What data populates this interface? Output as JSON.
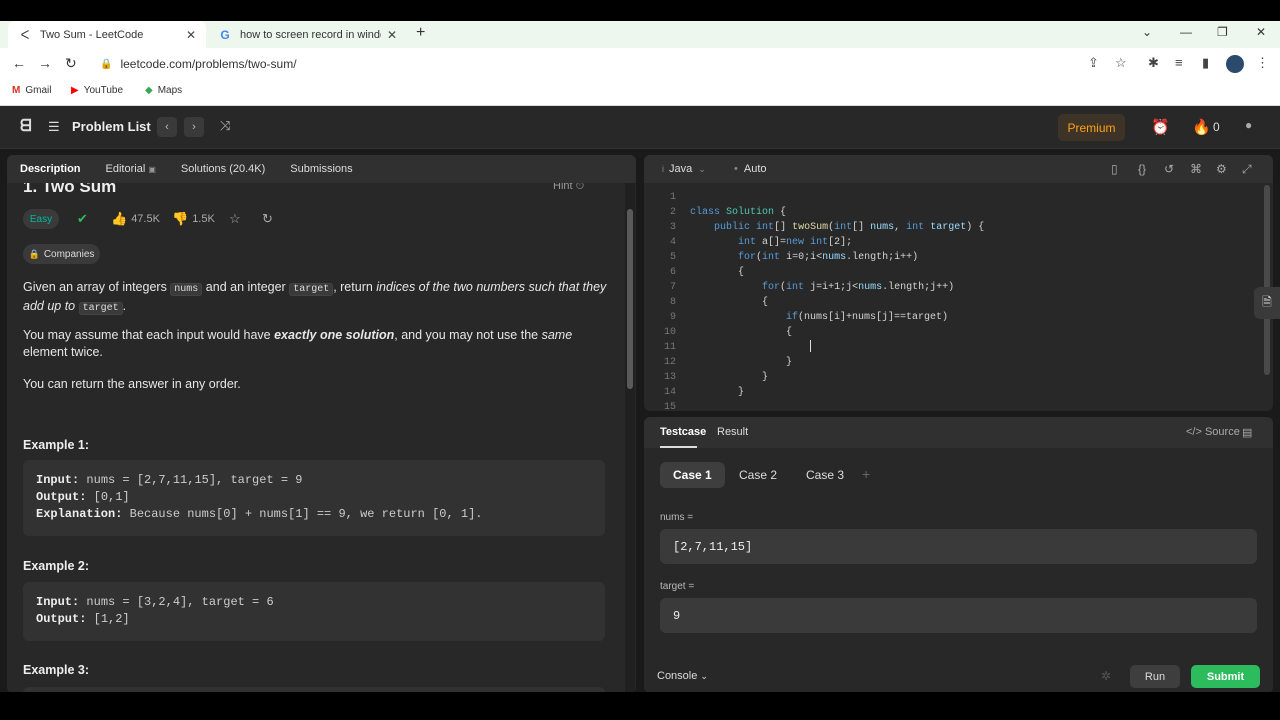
{
  "browser": {
    "tabs": [
      {
        "title": "Two Sum - LeetCode",
        "icon": "leetcode-icon"
      },
      {
        "title": "how to screen record in window",
        "icon": "google-icon"
      }
    ],
    "url": "leetcode.com/problems/two-sum/",
    "bookmarks": [
      {
        "label": "Gmail",
        "icon": "gmail-icon"
      },
      {
        "label": "YouTube",
        "icon": "youtube-icon"
      },
      {
        "label": "Maps",
        "icon": "maps-icon"
      }
    ]
  },
  "navbar": {
    "problem_list": "Problem List",
    "premium": "Premium",
    "streak": "0"
  },
  "left_tabs": [
    "Description",
    "Editorial",
    "Solutions (20.4K)",
    "Submissions"
  ],
  "problem": {
    "title": "1. Two Sum",
    "hint": "Hint",
    "difficulty": "Easy",
    "likes": "47.5K",
    "dislikes": "1.5K",
    "companies": "Companies",
    "p1_a": "Given an array of integers ",
    "p1_code1": "nums",
    "p1_b": " and an integer ",
    "p1_code2": "target",
    "p1_c": ", return ",
    "p1_em": "indices of the two numbers such that they add up to",
    "p1_code3": "target",
    "p1_d": ".",
    "p2_a": "You may assume that each input would have ",
    "p2_strong": "exactly one solution",
    "p2_b": ", and you may not use the ",
    "p2_em": "same",
    "p2_c": " element twice.",
    "p3": "You can return the answer in any order.",
    "examples": [
      {
        "title": "Example 1:",
        "input": "nums = [2,7,11,15], target = 9",
        "output": "[0,1]",
        "explanation": "Because nums[0] + nums[1] == 9, we return [0, 1]."
      },
      {
        "title": "Example 2:",
        "input": "nums = [3,2,4], target = 6",
        "output": "[1,2]"
      },
      {
        "title": "Example 3:"
      }
    ],
    "labels": {
      "input": "Input:",
      "output": "Output:",
      "explanation": "Explanation:"
    }
  },
  "editor": {
    "language": "Java",
    "mode": "Auto",
    "line_numbers": [
      "1",
      "2",
      "3",
      "4",
      "5",
      "6",
      "7",
      "8",
      "9",
      "10",
      "11",
      "12",
      "13",
      "14",
      "15"
    ],
    "code_lines": [
      "class Solution {",
      "    public int[] twoSum(int[] nums, int target) {",
      "        int a[]=new int[2];",
      "        for(int i=0;i<nums.length;i++)",
      "        {",
      "            for(int j=i+1;j<nums.length;j++)",
      "            {",
      "                if(nums[i]+nums[j]==target)",
      "                {",
      "",
      "                }",
      "            }",
      "        }",
      "",
      ""
    ]
  },
  "testcase": {
    "tabs": [
      "Testcase",
      "Result"
    ],
    "source": "Source",
    "cases": [
      "Case 1",
      "Case 2",
      "Case 3"
    ],
    "params": [
      {
        "label": "nums =",
        "value": "[2,7,11,15]"
      },
      {
        "label": "target =",
        "value": "9"
      }
    ],
    "console": "Console",
    "run": "Run",
    "submit": "Submit"
  }
}
